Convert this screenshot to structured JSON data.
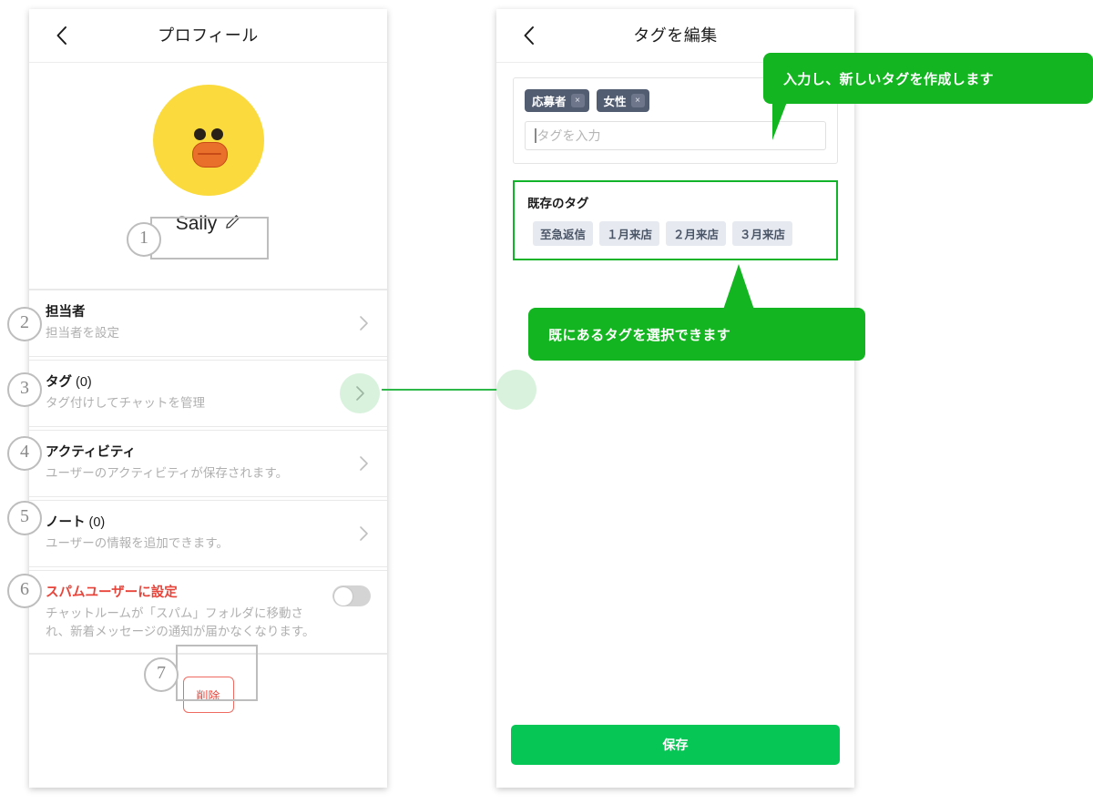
{
  "left_phone": {
    "header": {
      "title": "プロフィール",
      "back_icon": "chevron-left-icon"
    },
    "profile": {
      "avatar_alt": "sally-avatar",
      "name": "Sally",
      "edit_icon": "pencil-icon"
    },
    "rows": [
      {
        "num": "2",
        "title": "担当者",
        "count": "",
        "sub": "担当者を設定",
        "chevron": "chevron-right-icon"
      },
      {
        "num": "3",
        "title": "タグ",
        "count": " (0)",
        "sub": "タグ付けしてチャットを管理",
        "chevron": "chevron-right-icon"
      },
      {
        "num": "4",
        "title": "アクティビティ",
        "count": "",
        "sub": "ユーザーのアクティビティが保存されます。",
        "chevron": "chevron-right-icon"
      },
      {
        "num": "5",
        "title": "ノート",
        "count": " (0)",
        "sub": "ユーザーの情報を追加できます。",
        "chevron": "chevron-right-icon"
      },
      {
        "num": "6",
        "title": "スパムユーザーに設定",
        "count": "",
        "sub": "チャットルームが「スパム」フォルダに移動され、新着メッセージの通知が届かなくなります。",
        "toggle_state": "off"
      }
    ],
    "delete": {
      "num": "7",
      "label": "削除"
    },
    "name_annotation_num": "1"
  },
  "right_phone": {
    "header": {
      "title": "タグを編集",
      "back_icon": "chevron-left-icon"
    },
    "tag_input": {
      "chips": [
        {
          "label": "応募者",
          "remove_icon": "×"
        },
        {
          "label": "女性",
          "remove_icon": "×"
        }
      ],
      "placeholder": "タグを入力",
      "value": ""
    },
    "existing": {
      "title": "既存のタグ",
      "tags": [
        "至急返信",
        "１月来店",
        "２月来店",
        "３月来店"
      ]
    },
    "save_label": "保存"
  },
  "callouts": [
    {
      "id": "top",
      "text": "入力し、新しいタグを作成します"
    },
    {
      "id": "bottom",
      "text": "既にあるタグを選択できます"
    }
  ],
  "colors": {
    "brand_green": "#06c755",
    "callout_green": "#13b620",
    "accent_green": "#11b328",
    "danger_red": "#e8443a",
    "chip_dark": "#535d72",
    "chip_light": "#e6eaf0",
    "avatar_yellow": "#fada3c",
    "annotation_gray": "#bdbdbd"
  }
}
